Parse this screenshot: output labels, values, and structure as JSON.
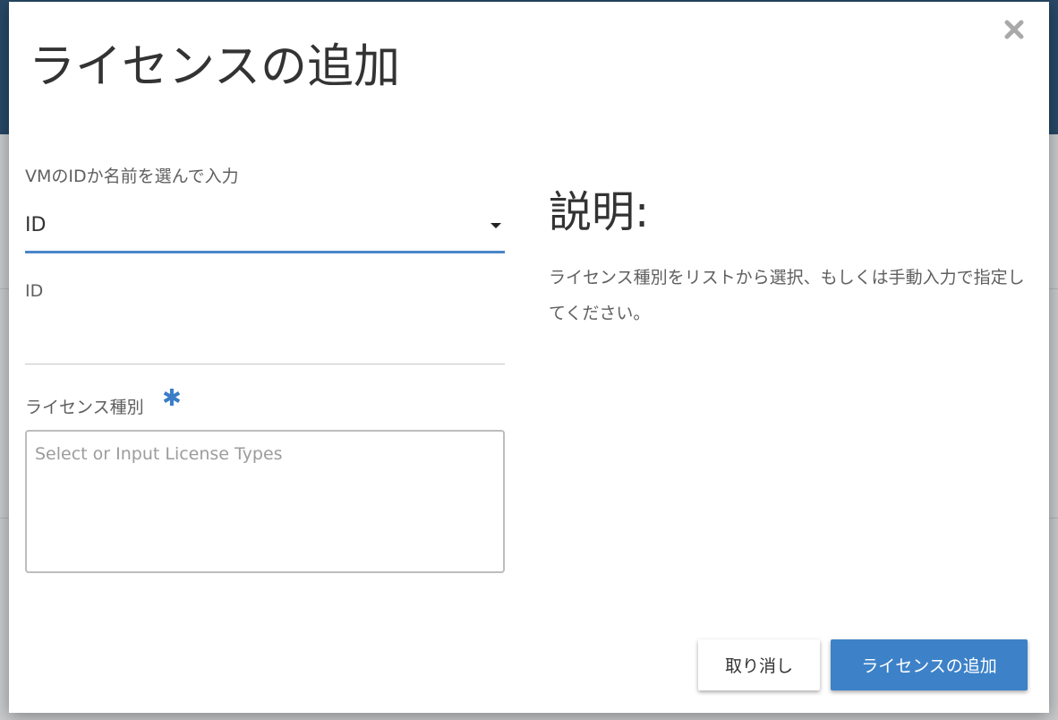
{
  "dialog": {
    "title": "ライセンスの追加",
    "close_icon": "close-x-icon"
  },
  "form": {
    "vm_selector": {
      "label": "VMのIDか名前を選んで入力",
      "selected": "ID"
    },
    "id_field": {
      "label": "ID",
      "value": ""
    },
    "license_types": {
      "label": "ライセンス種別",
      "required_mark": "✱",
      "placeholder": "Select or Input License Types"
    }
  },
  "description": {
    "title": "説明:",
    "text": "ライセンス種別をリストから選択、もしくは手動入力で指定してください。"
  },
  "buttons": {
    "cancel": "取り消し",
    "submit": "ライセンスの追加"
  },
  "colors": {
    "accent": "#3d82c8",
    "select_underline": "#4a86c7",
    "required": "#3b7dc6"
  }
}
